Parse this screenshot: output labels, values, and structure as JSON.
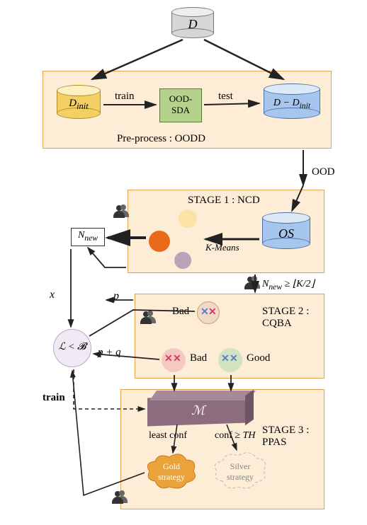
{
  "top_db": {
    "label": "D"
  },
  "preprocess": {
    "label": "Pre-process : OODD",
    "db_left": "D_init",
    "train": "train",
    "oodsda": "OOD-\nSDA",
    "test": "test",
    "db_right": "D − D_init"
  },
  "ood_label": "OOD",
  "stage1": {
    "title": "STAGE 1 : NCD",
    "kmeans": "K-Means",
    "os": "OS"
  },
  "n_new": "N_new",
  "cond1": "N_new ≥ ⌊K/2⌋",
  "x_label": "x",
  "p_label": "p",
  "pq_label": "p + q",
  "budget": "ℒ < 𝓑",
  "train_label": "train",
  "stage2": {
    "title": "STAGE 2 :\nCQBA",
    "bad": "Bad",
    "good": "Good"
  },
  "stage3": {
    "title": "STAGE 3 :\nPPAS",
    "m": "ℳ",
    "least_conf": "least   conf",
    "conf_th": "conf  ≥ TH",
    "gold": "Gold\nstrategy",
    "silver": "Silver\nstrategy"
  },
  "chart_data": {
    "type": "diagram",
    "nodes": [
      {
        "id": "D",
        "label": "D",
        "kind": "database"
      },
      {
        "id": "D_init",
        "label": "D_init",
        "kind": "database"
      },
      {
        "id": "OOD-SDA",
        "label": "OOD-SDA",
        "kind": "process"
      },
      {
        "id": "D-Dinit",
        "label": "D − D_init",
        "kind": "database"
      },
      {
        "id": "pre",
        "label": "Pre-process : OODD",
        "kind": "box"
      },
      {
        "id": "OS",
        "label": "OS",
        "kind": "database"
      },
      {
        "id": "NCD",
        "label": "STAGE 1 : NCD",
        "kind": "box"
      },
      {
        "id": "KMeans",
        "label": "K-Means",
        "kind": "process"
      },
      {
        "id": "clusters",
        "label": "clusters",
        "kind": "cluster"
      },
      {
        "id": "N_new",
        "label": "N_new",
        "kind": "value"
      },
      {
        "id": "CQBA",
        "label": "STAGE 2 : CQBA",
        "kind": "box"
      },
      {
        "id": "bad1",
        "label": "Bad",
        "kind": "sample"
      },
      {
        "id": "bad2",
        "label": "Bad",
        "kind": "sample"
      },
      {
        "id": "good",
        "label": "Good",
        "kind": "sample"
      },
      {
        "id": "budget",
        "label": "ℒ < 𝓑",
        "kind": "decision"
      },
      {
        "id": "M",
        "label": "ℳ",
        "kind": "model"
      },
      {
        "id": "PPAS",
        "label": "STAGE 3 : PPAS",
        "kind": "box"
      },
      {
        "id": "gold",
        "label": "Gold strategy",
        "kind": "strategy"
      },
      {
        "id": "silver",
        "label": "Silver strategy",
        "kind": "strategy"
      }
    ],
    "edges": [
      {
        "from": "D",
        "to": "D_init"
      },
      {
        "from": "D",
        "to": "D-Dinit"
      },
      {
        "from": "D_init",
        "to": "OOD-SDA",
        "label": "train"
      },
      {
        "from": "OOD-SDA",
        "to": "D-Dinit",
        "label": "test"
      },
      {
        "from": "D-Dinit",
        "to": "OS",
        "label": "OOD"
      },
      {
        "from": "OS",
        "to": "clusters",
        "label": "K-Means"
      },
      {
        "from": "clusters",
        "to": "N_new"
      },
      {
        "from": "N_new",
        "to": "budget",
        "label": "x"
      },
      {
        "from": "good",
        "to": "budget",
        "label": "p"
      },
      {
        "from": "bad2",
        "to": "budget",
        "label": "p + q"
      },
      {
        "from": "NCD",
        "to": "CQBA",
        "label": "N_new ≥ ⌊K/2⌋"
      },
      {
        "from": "bad2",
        "to": "M"
      },
      {
        "from": "good",
        "to": "M"
      },
      {
        "from": "M",
        "to": "gold",
        "label": "least conf"
      },
      {
        "from": "M",
        "to": "silver",
        "label": "conf ≥ TH"
      },
      {
        "from": "gold",
        "to": "budget"
      },
      {
        "from": "budget",
        "to": "M",
        "label": "train",
        "style": "dashed"
      }
    ]
  }
}
